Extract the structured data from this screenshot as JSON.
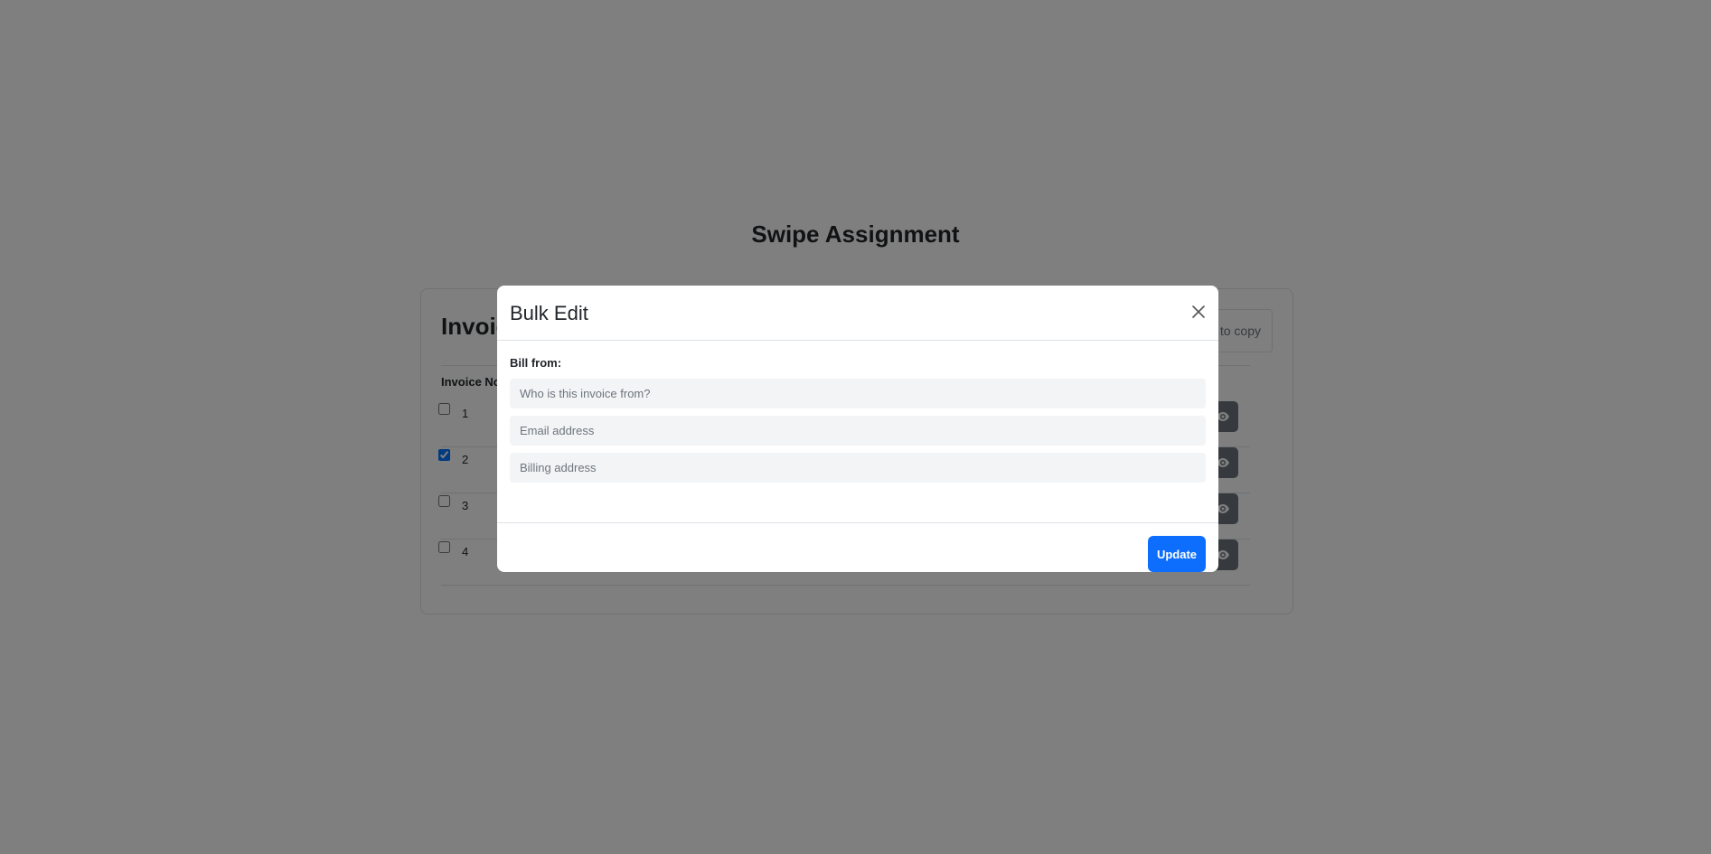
{
  "page": {
    "title": "Swipe Assignment"
  },
  "card": {
    "title": "Invoice List",
    "copy_hint": "Click to copy",
    "table": {
      "header": "Invoice No.",
      "rows": [
        {
          "number": "1",
          "checked": false
        },
        {
          "number": "2",
          "checked": true
        },
        {
          "number": "3",
          "checked": false
        },
        {
          "number": "4",
          "checked": false
        }
      ]
    }
  },
  "modal": {
    "title": "Bulk Edit",
    "bill_from_label": "Bill from:",
    "fields": {
      "name_placeholder": "Who is this invoice from?",
      "email_placeholder": "Email address",
      "address_placeholder": "Billing address"
    },
    "update_label": "Update"
  },
  "icons": {
    "close": "close-icon",
    "view": "eye-icon"
  },
  "colors": {
    "primary": "#0d6efd",
    "danger": "#dc3545",
    "secondary": "#6c757d",
    "overlay": "rgba(0,0,0,0.5)"
  }
}
